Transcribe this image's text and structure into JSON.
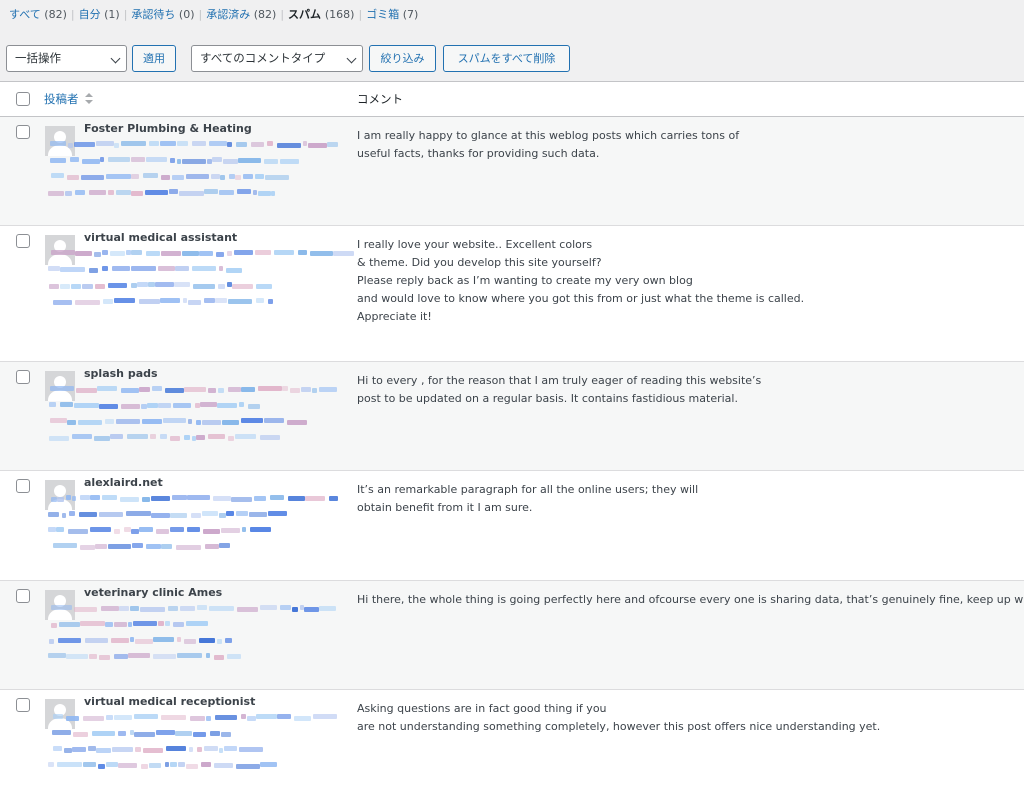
{
  "filters": [
    {
      "label": "すべて",
      "count": "(82)",
      "current": false
    },
    {
      "label": "自分",
      "count": "(1)",
      "current": false
    },
    {
      "label": "承認待ち",
      "count": "(0)",
      "current": false
    },
    {
      "label": "承認済み",
      "count": "(82)",
      "current": false
    },
    {
      "label": "スパム",
      "count": "(168)",
      "current": true
    },
    {
      "label": "ゴミ箱",
      "count": "(7)",
      "current": false
    }
  ],
  "toolbar": {
    "bulk_action_selected": "一括操作",
    "apply_label": "適用",
    "comment_type_selected": "すべてのコメントタイプ",
    "filter_label": "絞り込み",
    "empty_spam_label": "スパムをすべて削除"
  },
  "table": {
    "col_author": "投稿者",
    "col_comment": "コメント"
  },
  "comments": [
    {
      "author": "Foster Plumbing & Heating",
      "lines": [
        "I am really happy to glance at this weblog posts which carries tons of",
        "useful facts, thanks for providing such data."
      ]
    },
    {
      "author": "virtual medical assistant",
      "lines": [
        "I really love your website.. Excellent colors",
        "& theme. Did you develop this site yourself?",
        "Please reply back as I’m wanting to create my very own blog",
        "and would love to know where you got this from or just what the theme is called.",
        "Appreciate it!"
      ]
    },
    {
      "author": "splash pads",
      "lines": [
        "Hi to every , for the reason that I am truly eager of reading this website’s",
        "post to be updated on a regular basis. It contains fastidious material."
      ]
    },
    {
      "author": "alexlaird.net",
      "lines": [
        "It’s an remarkable paragraph for all the online users; they will",
        "obtain benefit from it I am sure."
      ]
    },
    {
      "author": "veterinary clinic Ames",
      "lines": [
        "Hi there, the whole thing is going perfectly here and ofcourse every one is sharing data, that’s genuinely fine, keep up writing."
      ]
    },
    {
      "author": "virtual medical receptionist",
      "lines": [
        "Asking questions are in fact good thing if you",
        "are not understanding something completely, however this post offers nice understanding yet."
      ]
    }
  ],
  "colors": {
    "link": "#2271b1",
    "redaction_palette": [
      "#4f7fe3",
      "#8fb7f2",
      "#c9a3c8",
      "#7fb3e8",
      "#b0c4ef",
      "#3a6fd6",
      "#e0b3c9",
      "#a9d0f5"
    ]
  }
}
